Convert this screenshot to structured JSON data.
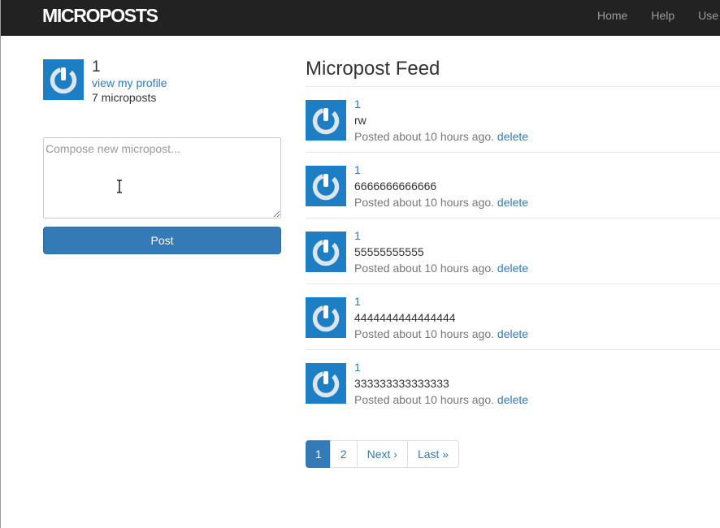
{
  "navbar": {
    "brand": "MICROPOSTS",
    "links": [
      "Home",
      "Help",
      "Use"
    ],
    "background": "#222222"
  },
  "sidebar": {
    "user_name": "1",
    "profile_link": "view my profile",
    "post_count": "7 microposts",
    "compose_placeholder": "Compose new micropost...",
    "post_button": "Post",
    "accent": "#337ab7"
  },
  "feed": {
    "title": "Micropost Feed",
    "items": [
      {
        "user": "1",
        "content": "rw",
        "meta": "Posted about 10 hours ago.",
        "delete": "delete"
      },
      {
        "user": "1",
        "content": "6666666666666",
        "meta": "Posted about 10 hours ago.",
        "delete": "delete"
      },
      {
        "user": "1",
        "content": "55555555555",
        "meta": "Posted about 10 hours ago.",
        "delete": "delete"
      },
      {
        "user": "1",
        "content": "4444444444444444",
        "meta": "Posted about 10 hours ago.",
        "delete": "delete"
      },
      {
        "user": "1",
        "content": "333333333333333",
        "meta": "Posted about 10 hours ago.",
        "delete": "delete"
      }
    ]
  },
  "pagination": {
    "pages": [
      "1",
      "2"
    ],
    "current": "1",
    "next": "Next ›",
    "last": "Last »"
  },
  "icons": {
    "avatar": "gravatar-power-icon",
    "cursor": "text-cursor-icon"
  }
}
